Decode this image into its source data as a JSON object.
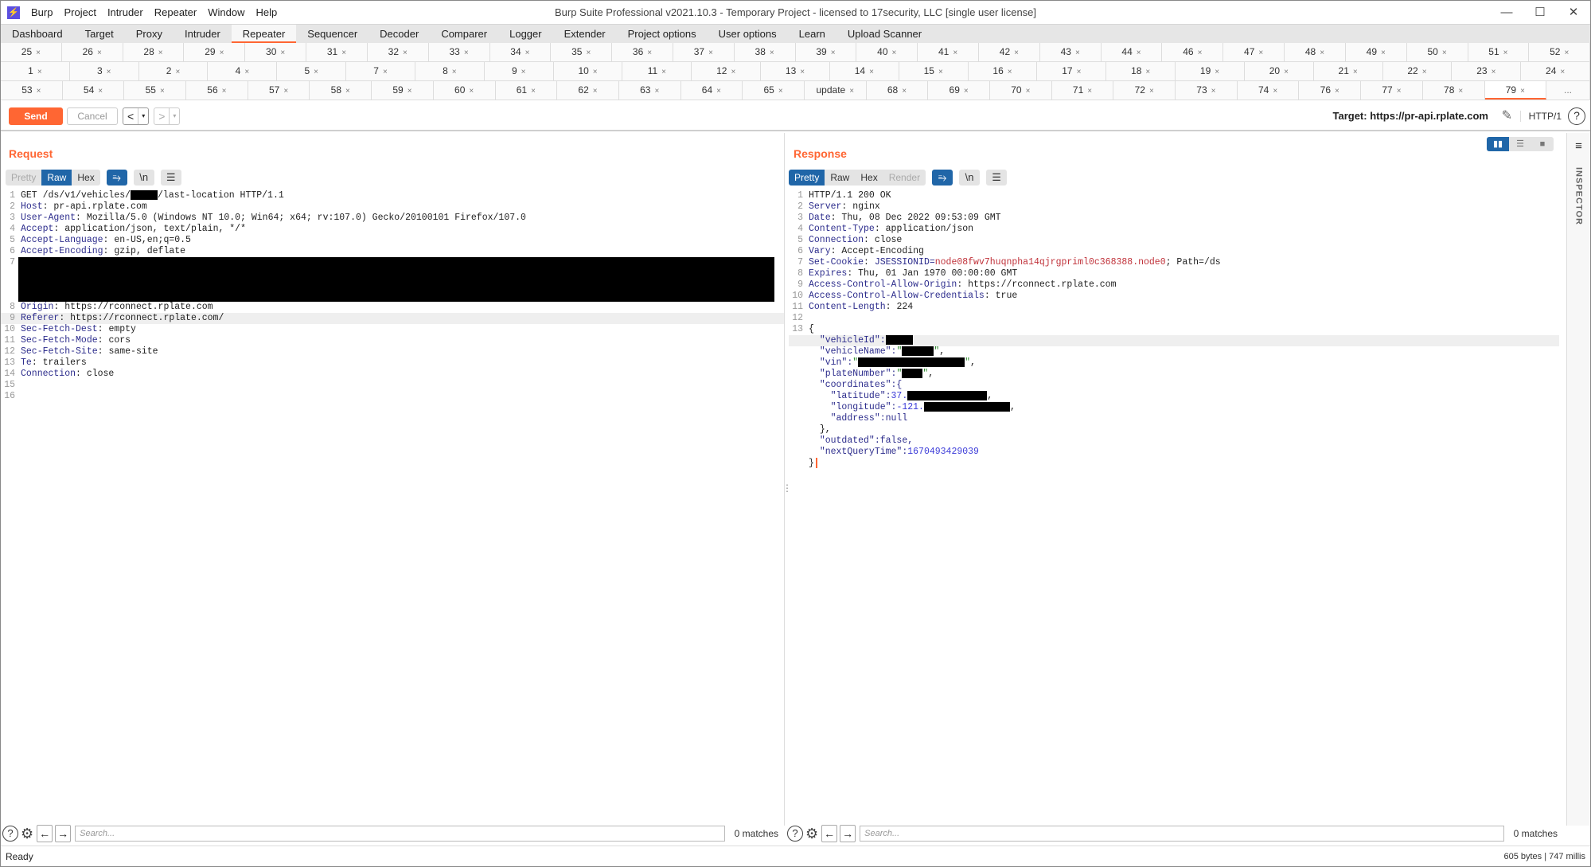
{
  "app": {
    "title": "Burp Suite Professional v2021.10.3 - Temporary Project - licensed to 17security, LLC [single user license]",
    "logo": "⚡",
    "menu": [
      "Burp",
      "Project",
      "Intruder",
      "Repeater",
      "Window",
      "Help"
    ],
    "window_controls": {
      "minimize": "—",
      "maximize": "☐",
      "close": "✕"
    }
  },
  "main_tabs": [
    {
      "label": "Dashboard"
    },
    {
      "label": "Target"
    },
    {
      "label": "Proxy"
    },
    {
      "label": "Intruder"
    },
    {
      "label": "Repeater",
      "active": true
    },
    {
      "label": "Sequencer"
    },
    {
      "label": "Decoder"
    },
    {
      "label": "Comparer"
    },
    {
      "label": "Logger"
    },
    {
      "label": "Extender"
    },
    {
      "label": "Project options"
    },
    {
      "label": "User options"
    },
    {
      "label": "Learn"
    },
    {
      "label": "Upload Scanner"
    }
  ],
  "repeater_tabs": {
    "rows": [
      [
        "25",
        "26",
        "28",
        "29",
        "30",
        "31",
        "32",
        "33",
        "34",
        "35",
        "36",
        "37",
        "38",
        "39",
        "40",
        "41",
        "42",
        "43",
        "44",
        "46",
        "47",
        "48",
        "49",
        "50",
        "51",
        "52"
      ],
      [
        "1",
        "3",
        "2",
        "4",
        "5",
        "7",
        "8",
        "9",
        "10",
        "11",
        "12",
        "13",
        "14",
        "15",
        "16",
        "17",
        "18",
        "19",
        "20",
        "21",
        "22",
        "23",
        "24"
      ],
      [
        "53",
        "54",
        "55",
        "56",
        "57",
        "58",
        "59",
        "60",
        "61",
        "62",
        "63",
        "64",
        "65",
        "update",
        "68",
        "69",
        "70",
        "71",
        "72",
        "73",
        "74",
        "76",
        "77",
        "78",
        "79"
      ]
    ],
    "active": "79",
    "close_glyph": "×",
    "more_label": "..."
  },
  "toolbar": {
    "send_label": "Send",
    "cancel_label": "Cancel",
    "back_glyph": "<",
    "forward_glyph": ">",
    "dropdown_glyph": "▾",
    "target_label": "Target: https://pr-api.rplate.com",
    "edit_icon": "✎",
    "http_version": "HTTP/1",
    "help_glyph": "?"
  },
  "request": {
    "title": "Request",
    "view_tabs": [
      {
        "label": "Pretty",
        "state": "dim"
      },
      {
        "label": "Raw",
        "state": "active"
      },
      {
        "label": "Hex",
        "state": "normal"
      }
    ],
    "icons": {
      "wrap": "⥱",
      "newline": "\\n",
      "menu": "☰"
    },
    "lines": [
      {
        "n": "1",
        "key": "",
        "value": "GET /ds/v1/vehicles/",
        "redact": true,
        "after": "/last-location HTTP/1.1"
      },
      {
        "n": "2",
        "key": "Host",
        "value": "pr-api.rplate.com"
      },
      {
        "n": "3",
        "key": "User-Agent",
        "value": "Mozilla/5.0 (Windows NT 10.0; Win64; x64; rv:107.0) Gecko/20100101 Firefox/107.0"
      },
      {
        "n": "4",
        "key": "Accept",
        "value": "application/json, text/plain, */*"
      },
      {
        "n": "5",
        "key": "Accept-Language",
        "value": "en-US,en;q=0.5"
      },
      {
        "n": "6",
        "key": "Accept-Encoding",
        "value": "gzip, deflate"
      },
      {
        "n": "7",
        "key": "",
        "value": "[redacted]"
      },
      {
        "n": "8",
        "key": "Origin",
        "value": "https://rconnect.rplate.com"
      },
      {
        "n": "9",
        "key": "Referer",
        "value": "https://rconnect.rplate.com/"
      },
      {
        "n": "10",
        "key": "Sec-Fetch-Dest",
        "value": "empty"
      },
      {
        "n": "11",
        "key": "Sec-Fetch-Mode",
        "value": "cors"
      },
      {
        "n": "12",
        "key": "Sec-Fetch-Site",
        "value": "same-site"
      },
      {
        "n": "13",
        "key": "Te",
        "value": "trailers"
      },
      {
        "n": "14",
        "key": "Connection",
        "value": "close"
      },
      {
        "n": "15",
        "key": "",
        "value": ""
      },
      {
        "n": "16",
        "key": "",
        "value": ""
      }
    ],
    "search_placeholder": "Search...",
    "matches": "0 matches"
  },
  "response": {
    "title": "Response",
    "view_tabs": [
      {
        "label": "Pretty",
        "state": "active"
      },
      {
        "label": "Raw",
        "state": "normal"
      },
      {
        "label": "Hex",
        "state": "normal"
      },
      {
        "label": "Render",
        "state": "dim"
      }
    ],
    "icons": {
      "wrap": "⥱",
      "newline": "\\n",
      "menu": "☰"
    },
    "header_lines": [
      {
        "n": "1",
        "key": "",
        "value": "HTTP/1.1 200 OK"
      },
      {
        "n": "2",
        "key": "Server",
        "value": "nginx"
      },
      {
        "n": "3",
        "key": "Date",
        "value": "Thu, 08 Dec 2022 09:53:09 GMT"
      },
      {
        "n": "4",
        "key": "Content-Type",
        "value": "application/json"
      },
      {
        "n": "5",
        "key": "Connection",
        "value": "close"
      },
      {
        "n": "6",
        "key": "Vary",
        "value": "Accept-Encoding"
      },
      {
        "n": "7",
        "key": "Set-Cookie",
        "value": "JSESSIONID=",
        "cookie": "node08fwv7huqnpha14qjrgpriml0c368388.node0",
        "after": "; Path=/ds"
      },
      {
        "n": "8",
        "key": "Expires",
        "value": "Thu, 01 Jan 1970 00:00:00 GMT"
      },
      {
        "n": "9",
        "key": "Access-Control-Allow-Origin",
        "value": "https://rconnect.rplate.com"
      },
      {
        "n": "10",
        "key": "Access-Control-Allow-Credentials",
        "value": "true"
      },
      {
        "n": "11",
        "key": "Content-Length",
        "value": "224"
      },
      {
        "n": "12",
        "key": "",
        "value": ""
      }
    ],
    "body": {
      "open_line": "13",
      "open": "{",
      "vehicleId_key": "\"vehicleId\":",
      "vehicleName_key": "\"vehicleName\":",
      "vin_key": "\"vin\":",
      "plateNumber_key": "\"plateNumber\":",
      "coordinates_key": "\"coordinates\":{",
      "latitude_key": "\"latitude\":",
      "latitude_visible": "37.",
      "longitude_key": "\"longitude\":",
      "longitude_visible": "-121.",
      "address_line": "\"address\":null",
      "close_coords": "},",
      "outdated_line": "\"outdated\":false,",
      "nextQueryTime_key": "\"nextQueryTime\":",
      "nextQueryTime_value": "1670493429039",
      "close": "}"
    },
    "search_placeholder": "Search...",
    "matches": "0 matches"
  },
  "layout_buttons": [
    "▮▮",
    "☰",
    "■"
  ],
  "inspector": {
    "label": "INSPECTOR",
    "menu_icon": "≡"
  },
  "status": {
    "left": "Ready",
    "right": "605 bytes | 747 millis"
  },
  "colors": {
    "accent": "#ff6633",
    "active_blue": "#2066a8",
    "header_key": "#2c2c8c",
    "cookie_value": "#c0323a",
    "json_number": "#3a3ad8"
  }
}
